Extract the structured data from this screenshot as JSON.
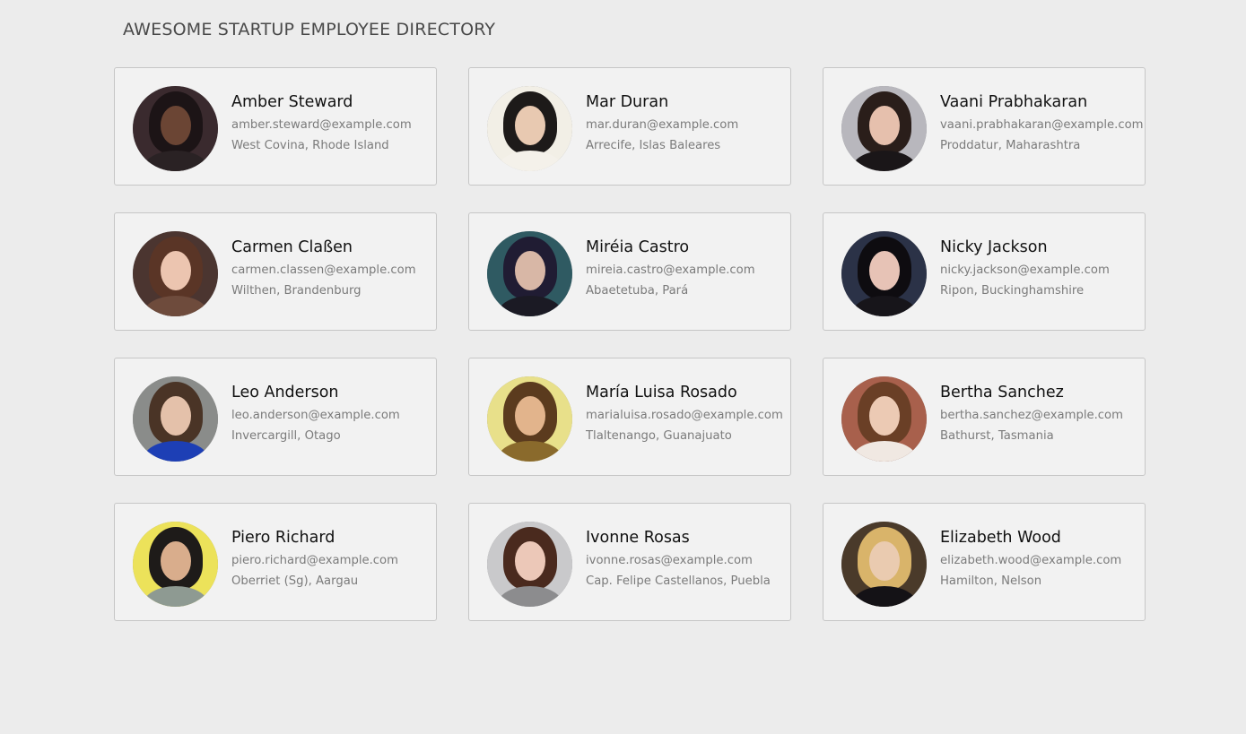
{
  "header": {
    "title": "AWESOME STARTUP EMPLOYEE DIRECTORY"
  },
  "employees": [
    {
      "name": "Amber Steward",
      "email": "amber.steward@example.com",
      "location": "West Covina, Rhode Island",
      "colors": {
        "bg": "#3a2a2e",
        "hair": "#1c1416",
        "face": "#6b4534",
        "body": "#2a2224"
      }
    },
    {
      "name": "Mar Duran",
      "email": "mar.duran@example.com",
      "location": "Arrecife, Islas Baleares",
      "colors": {
        "bg": "#f2efe6",
        "hair": "#1d1a19",
        "face": "#e8c9b1",
        "body": "#f4f1ea"
      }
    },
    {
      "name": "Vaani Prabhakaran",
      "email": "vaani.prabhakaran@example.com",
      "location": "Proddatur, Maharashtra",
      "colors": {
        "bg": "#b8b7bd",
        "hair": "#2a1e1a",
        "face": "#e6c0ad",
        "body": "#1a1618"
      }
    },
    {
      "name": "Carmen Claßen",
      "email": "carmen.classen@example.com",
      "location": "Wilthen, Brandenburg",
      "colors": {
        "bg": "#4b3530",
        "hair": "#5a3526",
        "face": "#ecc5b0",
        "body": "#6e4b3c"
      }
    },
    {
      "name": "Miréia Castro",
      "email": "mireia.castro@example.com",
      "location": "Abaetetuba, Pará",
      "colors": {
        "bg": "#2f5a62",
        "hair": "#201c33",
        "face": "#d8b7a6",
        "body": "#1b1a24"
      }
    },
    {
      "name": "Nicky Jackson",
      "email": "nicky.jackson@example.com",
      "location": "Ripon, Buckinghamshire",
      "colors": {
        "bg": "#2b3247",
        "hair": "#0e0c10",
        "face": "#e7c3b6",
        "body": "#17151a"
      }
    },
    {
      "name": "Leo Anderson",
      "email": "leo.anderson@example.com",
      "location": "Invercargill, Otago",
      "colors": {
        "bg": "#8a8c8a",
        "hair": "#4a3426",
        "face": "#e4c1aa",
        "body": "#1d3fb5"
      }
    },
    {
      "name": "María Luisa Rosado",
      "email": "marialuisa.rosado@example.com",
      "location": "Tlaltenango, Guanajuato",
      "colors": {
        "bg": "#e8e08a",
        "hair": "#5b3b1e",
        "face": "#e2b48c",
        "body": "#8a6a2c"
      }
    },
    {
      "name": "Bertha Sanchez",
      "email": "bertha.sanchez@example.com",
      "location": "Bathurst, Tasmania",
      "colors": {
        "bg": "#a8604c",
        "hair": "#6a3f26",
        "face": "#eccab4",
        "body": "#f0e8e2"
      }
    },
    {
      "name": "Piero Richard",
      "email": "piero.richard@example.com",
      "location": "Oberriet (Sg), Aargau",
      "colors": {
        "bg": "#ece25a",
        "hair": "#1e1b19",
        "face": "#d9ad8c",
        "body": "#8e9a92"
      }
    },
    {
      "name": "Ivonne Rosas",
      "email": "ivonne.rosas@example.com",
      "location": "Cap. Felipe Castellanos, Puebla",
      "colors": {
        "bg": "#c9c9cb",
        "hair": "#4a2a1e",
        "face": "#ecc8b8",
        "body": "#8c8c8e"
      }
    },
    {
      "name": "Elizabeth Wood",
      "email": "elizabeth.wood@example.com",
      "location": "Hamilton, Nelson",
      "colors": {
        "bg": "#4a3a2a",
        "hair": "#d9b46a",
        "face": "#eacbb0",
        "body": "#141216"
      }
    }
  ]
}
